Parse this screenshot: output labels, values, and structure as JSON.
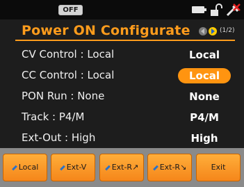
{
  "status": {
    "output_state": "OFF",
    "icons": [
      "battery-icon",
      "lock-icon",
      "remote-icon"
    ]
  },
  "header": {
    "title": "Power ON Configurate",
    "page": "(1/2)"
  },
  "rows": [
    {
      "label": "CV Control : Local",
      "value": "Local",
      "selected": false
    },
    {
      "label": "CC Control : Local",
      "value": "Local",
      "selected": true
    },
    {
      "label": "PON Run : None",
      "value": "None",
      "selected": false
    },
    {
      "label": "Track : P4/M",
      "value": "P4/M",
      "selected": false
    },
    {
      "label": "Ext-Out : High",
      "value": "High",
      "selected": false
    }
  ],
  "softkeys": [
    {
      "label": "Local",
      "icon": "pencil-icon"
    },
    {
      "label": "Ext-V",
      "icon": "pencil-icon"
    },
    {
      "label": "Ext-R↗",
      "icon": "pencil-icon"
    },
    {
      "label": "Ext-R↘",
      "icon": "pencil-icon"
    },
    {
      "label": "Exit",
      "icon": ""
    }
  ],
  "colors": {
    "accent": "#ff9c1c",
    "selection": "#ff9410",
    "background": "#1d1d1d",
    "softkey": "#f5861a"
  }
}
